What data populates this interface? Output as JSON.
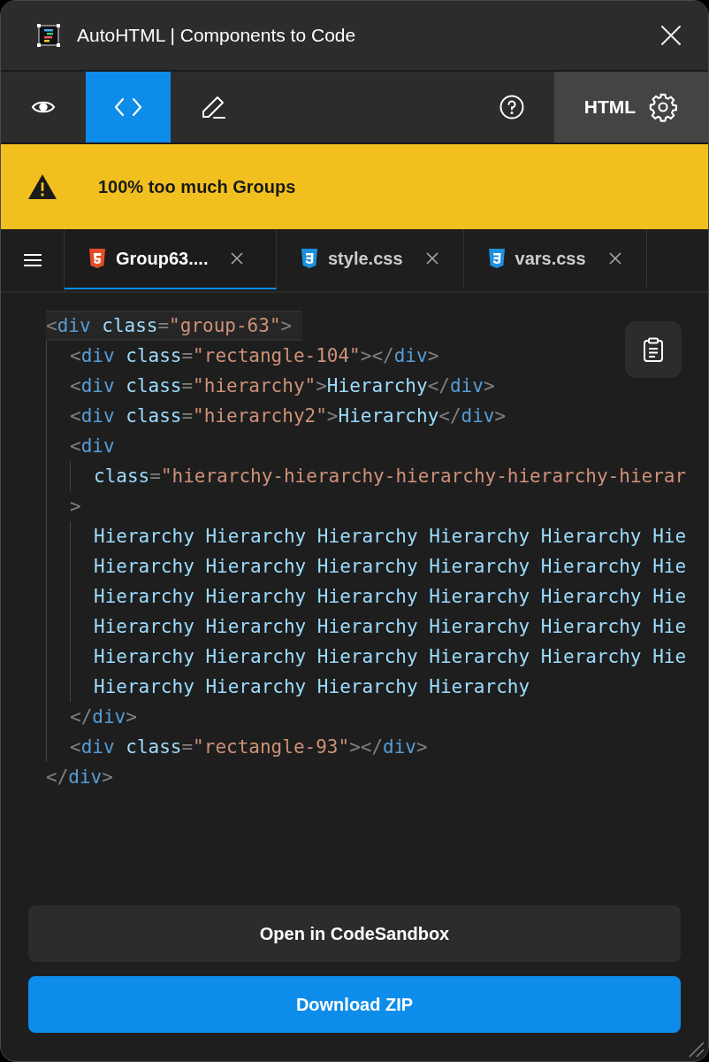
{
  "window": {
    "title": "AutoHTML | Components to Code"
  },
  "toolbar": {
    "modes": [
      {
        "kind": "preview",
        "selected": false
      },
      {
        "kind": "code",
        "selected": true
      },
      {
        "kind": "edit",
        "selected": false
      }
    ],
    "language": "HTML"
  },
  "warning": {
    "text": "100% too much Groups"
  },
  "tabs": [
    {
      "label": "Group63....",
      "kind": "html",
      "selected": true
    },
    {
      "label": "style.css",
      "kind": "css",
      "selected": false
    },
    {
      "label": "vars.css",
      "kind": "css",
      "selected": false
    }
  ],
  "code": {
    "lines": [
      {
        "current": true,
        "tokens": [
          {
            "kind": "punct",
            "text": "<"
          },
          {
            "kind": "tag",
            "text": "div"
          },
          {
            "kind": "attr",
            "text": "class"
          },
          {
            "kind": "punct",
            "text": "="
          },
          {
            "kind": "string",
            "text": "\"group-63\""
          },
          {
            "kind": "punct",
            "text": ">"
          }
        ],
        "children": [
          {
            "current": false,
            "tokens": [
              {
                "kind": "punct",
                "text": "<"
              },
              {
                "kind": "tag",
                "text": "div"
              },
              {
                "kind": "attr",
                "text": "class"
              },
              {
                "kind": "punct",
                "text": "="
              },
              {
                "kind": "string",
                "text": "\"rectangle-104\""
              },
              {
                "kind": "punct",
                "text": "></"
              },
              {
                "kind": "tag",
                "text": "div"
              },
              {
                "kind": "punct",
                "text": ">"
              }
            ]
          },
          {
            "current": false,
            "tokens": [
              {
                "kind": "punct",
                "text": "<"
              },
              {
                "kind": "tag",
                "text": "div"
              },
              {
                "kind": "attr",
                "text": "class"
              },
              {
                "kind": "punct",
                "text": "="
              },
              {
                "kind": "string",
                "text": "\"hierarchy\""
              },
              {
                "kind": "punct",
                "text": ">"
              },
              {
                "kind": "text",
                "text": "Hierarchy"
              },
              {
                "kind": "punct",
                "text": "</"
              },
              {
                "kind": "tag",
                "text": "div"
              },
              {
                "kind": "punct",
                "text": ">"
              }
            ]
          },
          {
            "current": false,
            "tokens": [
              {
                "kind": "punct",
                "text": "<"
              },
              {
                "kind": "tag",
                "text": "div"
              },
              {
                "kind": "attr",
                "text": "class"
              },
              {
                "kind": "punct",
                "text": "="
              },
              {
                "kind": "string",
                "text": "\"hierarchy2\""
              },
              {
                "kind": "punct",
                "text": ">"
              },
              {
                "kind": "text",
                "text": "Hierarchy"
              },
              {
                "kind": "punct",
                "text": "</"
              },
              {
                "kind": "tag",
                "text": "div"
              },
              {
                "kind": "punct",
                "text": ">"
              }
            ]
          },
          {
            "current": false,
            "tokens": [
              {
                "kind": "punct",
                "text": "<"
              },
              {
                "kind": "tag",
                "text": "div"
              }
            ],
            "children": [
              {
                "current": false,
                "tokens": [
                  {
                    "kind": "attr",
                    "text": "class"
                  },
                  {
                    "kind": "punct",
                    "text": "="
                  },
                  {
                    "kind": "string",
                    "text": "\"hierarchy-hierarchy-hierarchy-hierarchy-hierar"
                  }
                ]
              }
            ]
          },
          {
            "current": false,
            "tokens": [
              {
                "kind": "punct",
                "text": ">"
              }
            ],
            "children": [
              {
                "current": false,
                "tokens": [
                  {
                    "kind": "text",
                    "text": "Hierarchy Hierarchy Hierarchy Hierarchy Hierarchy Hie"
                  }
                ]
              },
              {
                "current": false,
                "tokens": [
                  {
                    "kind": "text",
                    "text": "Hierarchy Hierarchy Hierarchy Hierarchy Hierarchy Hie"
                  }
                ]
              },
              {
                "current": false,
                "tokens": [
                  {
                    "kind": "text",
                    "text": "Hierarchy Hierarchy Hierarchy Hierarchy Hierarchy Hie"
                  }
                ]
              },
              {
                "current": false,
                "tokens": [
                  {
                    "kind": "text",
                    "text": "Hierarchy Hierarchy Hierarchy Hierarchy Hierarchy Hie"
                  }
                ]
              },
              {
                "current": false,
                "tokens": [
                  {
                    "kind": "text",
                    "text": "Hierarchy Hierarchy Hierarchy Hierarchy Hierarchy Hie"
                  }
                ]
              },
              {
                "current": false,
                "tokens": [
                  {
                    "kind": "text",
                    "text": "Hierarchy Hierarchy Hierarchy Hierarchy"
                  }
                ]
              }
            ]
          },
          {
            "current": false,
            "tokens": [
              {
                "kind": "punct",
                "text": "</"
              },
              {
                "kind": "tag",
                "text": "div"
              },
              {
                "kind": "punct",
                "text": ">"
              }
            ]
          },
          {
            "current": false,
            "tokens": [
              {
                "kind": "punct",
                "text": "<"
              },
              {
                "kind": "tag",
                "text": "div"
              },
              {
                "kind": "attr",
                "text": "class"
              },
              {
                "kind": "punct",
                "text": "="
              },
              {
                "kind": "string",
                "text": "\"rectangle-93\""
              },
              {
                "kind": "punct",
                "text": "></"
              },
              {
                "kind": "tag",
                "text": "div"
              },
              {
                "kind": "punct",
                "text": ">"
              }
            ]
          }
        ]
      },
      {
        "current": false,
        "tokens": [
          {
            "kind": "punct",
            "text": "</"
          },
          {
            "kind": "tag",
            "text": "div"
          },
          {
            "kind": "punct",
            "text": ">"
          }
        ]
      }
    ]
  },
  "buttons": [
    {
      "label": "Open in CodeSandbox",
      "kind": "secondary"
    },
    {
      "label": "Download ZIP",
      "kind": "primary"
    }
  ]
}
